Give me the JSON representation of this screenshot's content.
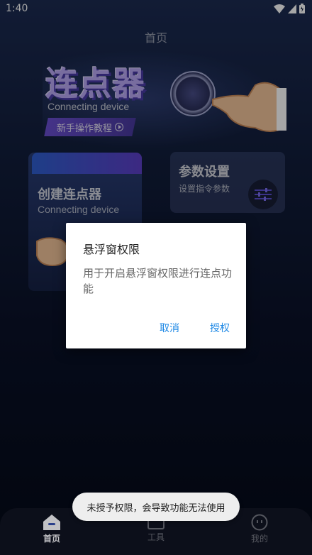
{
  "status_bar": {
    "time": "1:40"
  },
  "header": {
    "title": "首页"
  },
  "hero": {
    "title": "连点器",
    "subtitle": "Connecting device",
    "tutorial_label": "新手操作教程"
  },
  "cards": {
    "create": {
      "title": "创建连点器",
      "subtitle": "Connecting device"
    },
    "params": {
      "title": "参数设置",
      "subtitle": "设置指令参数"
    }
  },
  "dialog": {
    "title": "悬浮窗权限",
    "message": "用于开启悬浮窗权限进行连点功能",
    "cancel_label": "取消",
    "grant_label": "授权"
  },
  "toast": {
    "message": "未授予权限，会导致功能无法使用"
  },
  "bottom_nav": {
    "items": [
      {
        "label": "首页",
        "icon": "home-icon",
        "active": true
      },
      {
        "label": "工具",
        "icon": "calendar-tool-icon",
        "active": false
      },
      {
        "label": "我的",
        "icon": "smiley-profile-icon",
        "active": false
      }
    ]
  },
  "colors": {
    "accent_blue": "#1e88e5",
    "hero_purple": "#b9a8f5",
    "background_top": "#1c2b52",
    "background_bottom": "#050a18"
  }
}
